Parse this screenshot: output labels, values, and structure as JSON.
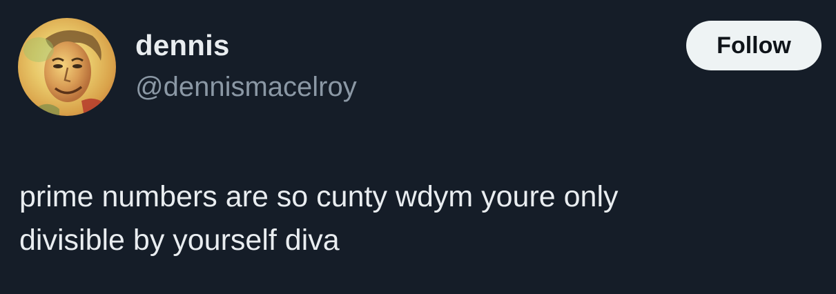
{
  "user": {
    "display_name": "dennis",
    "handle": "@dennismacelroy",
    "avatar_icon": "profile-photo-avatar"
  },
  "actions": {
    "follow_label": "Follow"
  },
  "tweet": {
    "lines": [
      "prime numbers are so cunty wdym youre only",
      "divisible by yourself diva"
    ]
  },
  "colors": {
    "background": "#151d28",
    "text_primary": "#e9edf0",
    "text_secondary": "#8b98a5",
    "button_bg": "#eef3f4"
  }
}
